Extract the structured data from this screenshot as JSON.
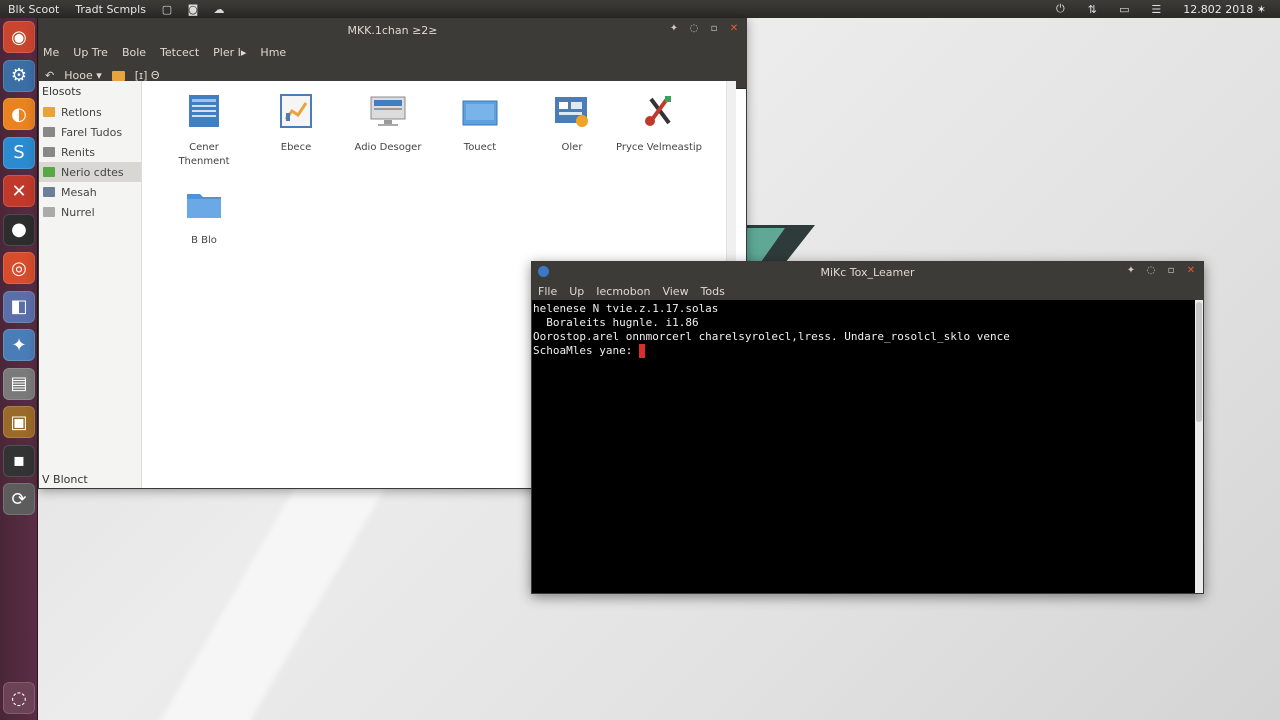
{
  "top_panel": {
    "app_name": "Blk Scoot",
    "menu_item": "Tradt Scmpls",
    "clock": "12.802 2018 ✶"
  },
  "launcher": {
    "items": [
      {
        "name": "launcher-dash-icon",
        "color": "#c9452e",
        "glyph": "◉"
      },
      {
        "name": "launcher-files-icon",
        "color": "#3a6ea5",
        "glyph": "⚙"
      },
      {
        "name": "launcher-firefox-icon",
        "color": "#e9821f",
        "glyph": "◐"
      },
      {
        "name": "launcher-terminal-icon",
        "color": "#2b8bd1",
        "glyph": "S"
      },
      {
        "name": "launcher-tools-icon",
        "color": "#c0392b",
        "glyph": "✕"
      },
      {
        "name": "launcher-media-icon",
        "color": "#2d2d2d",
        "glyph": "●"
      },
      {
        "name": "launcher-chrome-icon",
        "color": "#d64c2c",
        "glyph": "◎"
      },
      {
        "name": "launcher-people-icon",
        "color": "#5a6ea8",
        "glyph": "◧"
      },
      {
        "name": "launcher-settings-icon",
        "color": "#4a7db8",
        "glyph": "✦"
      },
      {
        "name": "launcher-drive-icon",
        "color": "#7a7a7a",
        "glyph": "▤"
      },
      {
        "name": "launcher-archive-icon",
        "color": "#9a6a2a",
        "glyph": "▣"
      },
      {
        "name": "launcher-calculator-icon",
        "color": "#333333",
        "glyph": "▪"
      },
      {
        "name": "launcher-update-icon",
        "color": "#5c5c5c",
        "glyph": "⟳"
      },
      {
        "name": "launcher-trash-icon",
        "color": "#6b4256",
        "glyph": "◌"
      }
    ]
  },
  "file_manager": {
    "title": "MKK.1chan ≥2≥",
    "menu": [
      "Me",
      "Up Tre",
      "Bole",
      "Tetcect",
      "Pler I▸",
      "Hme"
    ],
    "toolbar": {
      "location_label": "Hooe ▾",
      "extra": "[ɪ] Θ"
    },
    "sidebar_header": "Elosots",
    "sidebar_items": [
      {
        "label": "Retlons",
        "color": "#e9a33d"
      },
      {
        "label": "Farel Tudos",
        "color": "#888888"
      },
      {
        "label": "Renits",
        "color": "#888888"
      },
      {
        "label": "Nerio cdtes",
        "color": "#5aa845"
      },
      {
        "label": "Mesah",
        "color": "#6b7f99"
      },
      {
        "label": "Nurrel",
        "color": "#aaaaaa"
      }
    ],
    "sidebar_footer": "V Blonct",
    "items": [
      {
        "label": "Cener\nThenment",
        "icon": "document-icon"
      },
      {
        "label": "Ebece",
        "icon": "chart-doc-icon"
      },
      {
        "label": "Adio Desoger",
        "icon": "monitor-icon"
      },
      {
        "label": "Touect",
        "icon": "folder-blue-icon"
      },
      {
        "label": "Oler",
        "icon": "image-app-icon"
      },
      {
        "label": "Pryce Velmeastip",
        "icon": "tools-icon"
      },
      {
        "label": "B Blo",
        "icon": "folder-icon"
      }
    ]
  },
  "terminal": {
    "title": "MiKc Tox_Leamer",
    "menu": [
      "Flle",
      "Up",
      "Iecmobon",
      "View",
      "Tods"
    ],
    "lines": [
      "helenese N tvie.z.1.17.solas",
      "  Boraleits hugnle. i1.86",
      "Oorostop.arel onnmorcerl charelsyrolecl,lress. Undare_rosolcl_sklo vence",
      "",
      "SchoaMles yane: "
    ]
  },
  "colors": {
    "panel": "#3c3b37",
    "launcher": "#4a2638",
    "terminal_cursor": "#d5302b"
  }
}
